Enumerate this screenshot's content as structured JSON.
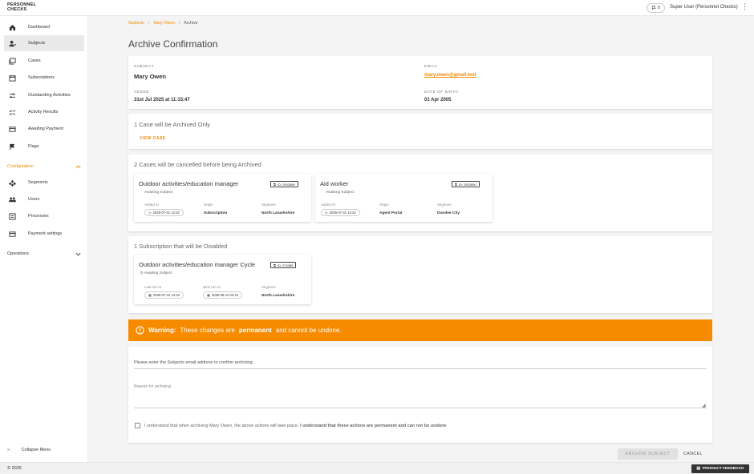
{
  "app": {
    "logo_line1": "PERSONNEL",
    "logo_line2": "CHECKS"
  },
  "topbar": {
    "flag_count": "0",
    "user_name": "Super User (Personnel Checks)"
  },
  "sidebar": {
    "items": [
      {
        "label": "Dashboard",
        "icon": "home-icon"
      },
      {
        "label": "Subjects",
        "icon": "person-icon",
        "active": true
      },
      {
        "label": "Cases",
        "icon": "cases-icon"
      },
      {
        "label": "Subscriptions",
        "icon": "calendar-icon"
      },
      {
        "label": "Outstanding Activities",
        "icon": "tune-icon"
      },
      {
        "label": "Activity Results",
        "icon": "checklist-icon"
      },
      {
        "label": "Awaiting Payment",
        "icon": "payment-icon"
      },
      {
        "label": "Flags",
        "icon": "flag-icon"
      }
    ],
    "config_label": "Configuration",
    "config_items": [
      {
        "label": "Segments",
        "icon": "segments-icon"
      },
      {
        "label": "Users",
        "icon": "users-icon"
      },
      {
        "label": "Processes",
        "icon": "process-icon"
      },
      {
        "label": "Payment settings",
        "icon": "card-icon"
      }
    ],
    "operations_label": "Operations",
    "collapse_label": "Collapse Menu"
  },
  "breadcrumb": {
    "subjects": "Subjects",
    "subject": "Mary Owen",
    "current": "Archive"
  },
  "page_title": "Archive Confirmation",
  "subject": {
    "subject_label": "SUBJECT",
    "subject_value": "Mary Owen",
    "email_label": "EMAIL",
    "email_value": "mary.owen@gmail.test",
    "added_label": "ADDED",
    "added_value": "31st Jul 2025 at 11:15:47",
    "dob_label": "DATE OF BIRTH",
    "dob_value": "01 Apr 2005"
  },
  "archived_only": {
    "heading": "1 Case will be Archived Only",
    "view_case": "VIEW CASE"
  },
  "cancelled": {
    "heading": "2 Cases will be cancelled before being Archived",
    "cards": [
      {
        "title": "Outdoor activities/education manager",
        "id": "ID: 2932889",
        "status": "Awaiting Subject",
        "added_label": "Added At",
        "added_value": "2025-07-31 12:22",
        "origin_label": "Origin",
        "origin_value": "Subscription",
        "segment_label": "Segment",
        "segment_value": "North Lanarkshire"
      },
      {
        "title": "Aid worker",
        "id": "ID: 2932890",
        "status": "Awaiting Subject",
        "added_label": "Added At",
        "added_value": "2025-07-31 12:22",
        "origin_label": "Origin",
        "origin_value": "Agent Portal",
        "segment_label": "Segment",
        "segment_value": "Dundee City"
      }
    ]
  },
  "disabled": {
    "heading": "1 Subscription that will be Disabled",
    "card": {
      "title": "Outdoor activities/education manager Cycle",
      "id": "ID: 274385",
      "status": "Awaiting Subject",
      "last_label": "Last run At",
      "last_value": "2025-07-31 12:22",
      "next_label": "Next run At",
      "next_value": "2025-08-14 02:22",
      "segment_label": "Segment",
      "segment_value": "North Lanarkshire"
    }
  },
  "warning": {
    "prefix": "Warning:",
    "text1": "These changes are",
    "bold": "permanent",
    "text2": "and cannot be undone."
  },
  "form": {
    "email_prompt": "Please enter the Subjects email address to confirm archiving.",
    "reason_label": "Reason for archiving",
    "ack_text": "I understand that when archiving Mary Owen, the above actions will take place.",
    "ack_bold": "I understand that these actions are permanent and can not be undone"
  },
  "actions": {
    "archive": "ARCHIVE SUBJECT",
    "cancel": "CANCEL"
  },
  "footer": {
    "copyright": "© 2025",
    "feedback": "PRODUCT FEEDBACK"
  },
  "colors": {
    "accent": "#f28a00",
    "warning": "#f68b00"
  }
}
